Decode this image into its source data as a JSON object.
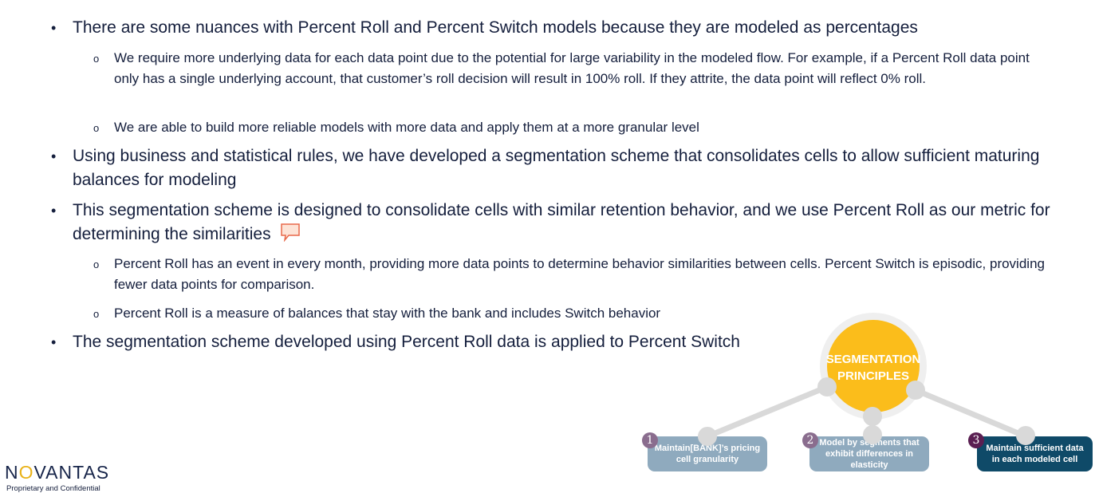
{
  "bullets": [
    {
      "level": 1,
      "text": "There are some nuances with Percent Roll and Percent Switch models because they are modeled as percentages"
    },
    {
      "level": 2,
      "text": "We require more underlying data for each data point due to the potential for large variability in the modeled flow. For example, if a Percent Roll data point only has a single underlying account, that customer’s roll decision will result in 100% roll. If they attrite, the data point will reflect 0% roll."
    },
    {
      "level": 2,
      "text": "We are able to build more reliable models with more data and apply them at a more granular level"
    },
    {
      "level": 1,
      "text": "Using business and statistical rules, we have developed a segmentation scheme that consolidates cells to allow sufficient maturing balances for modeling"
    },
    {
      "level": 1,
      "text": "This segmentation scheme is designed to consolidate cells with similar retention behavior, and we use Percent Roll as our metric for determining the similarities",
      "icon": "comment-icon"
    },
    {
      "level": 2,
      "text": "Percent Roll has an event in every month, providing more data points to determine behavior similarities between cells. Percent Switch is episodic, providing fewer data points for comparison."
    },
    {
      "level": 2,
      "text": "Percent Roll is a measure of balances that stay with the bank and includes Switch behavior"
    },
    {
      "level": 1,
      "text": "The segmentation scheme developed using Percent Roll data is applied to Percent Switch"
    }
  ],
  "markers": {
    "level1": "•",
    "level2": "o"
  },
  "diagram": {
    "hub_title": "SEGMENTATION PRINCIPLES",
    "principles": [
      {
        "number": "1",
        "text": "Maintain[BANK]’s pricing cell granularity",
        "color": "#8faabe",
        "badge": "#8a6d8e"
      },
      {
        "number": "2",
        "text": "Model by segments that exhibit differences in elasticity",
        "color": "#8faabe",
        "badge": "#8a6d8e"
      },
      {
        "number": "3",
        "text": "Maintain sufficient data in each modeled cell",
        "color": "#0f4a68",
        "badge": "#5a1f52"
      }
    ]
  },
  "logo": {
    "part1": "N",
    "part2": "O",
    "part3": "VANTAS"
  },
  "footer": "Proprietary and Confidential",
  "colors": {
    "text": "#141e3c",
    "hub": "#fbbd1b",
    "connector": "#d9d9d9"
  }
}
